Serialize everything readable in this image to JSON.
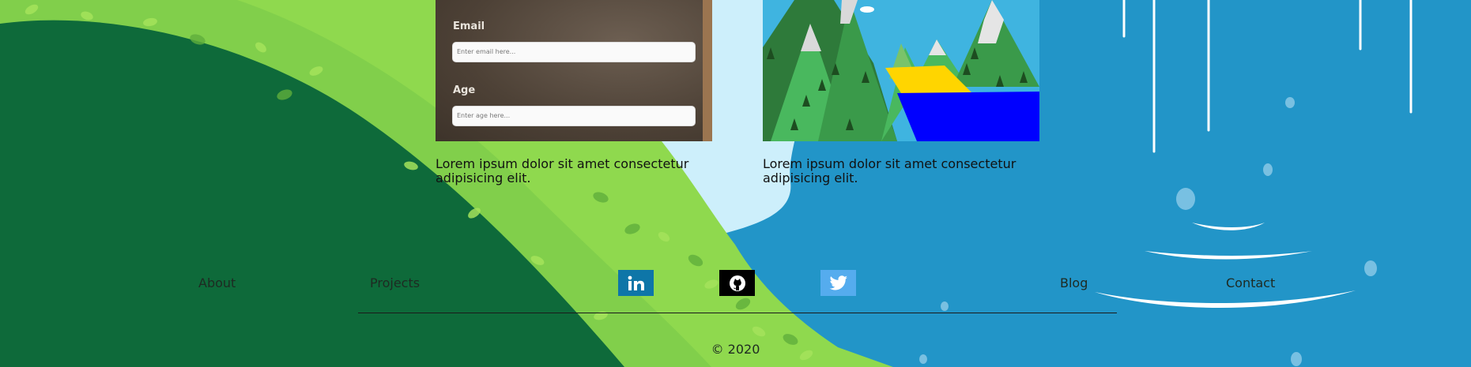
{
  "projects": [
    {
      "description": "Lorem ipsum dolor sit amet consectetur adipisicing elit.",
      "form": {
        "email_label": "Email",
        "email_placeholder": "Enter email here...",
        "age_label": "Age",
        "age_placeholder": "Enter age here..."
      }
    },
    {
      "description": "Lorem ipsum dolor sit amet consectetur adipisicing elit."
    }
  ],
  "footer": {
    "nav": {
      "about": "About",
      "projects": "Projects",
      "blog": "Blog",
      "contact": "Contact"
    },
    "social": [
      {
        "icon": "linkedin-icon",
        "color": "#0e76a8"
      },
      {
        "icon": "github-icon",
        "color": "#000000"
      },
      {
        "icon": "twitter-icon",
        "color": "#55acee"
      }
    ],
    "copyright": "© 2020"
  },
  "colors": {
    "dark_green": "#0e6a3a",
    "leaf_green": "#8fd94e",
    "water_blue": "#2295c8",
    "sky": "#cdeffb"
  }
}
